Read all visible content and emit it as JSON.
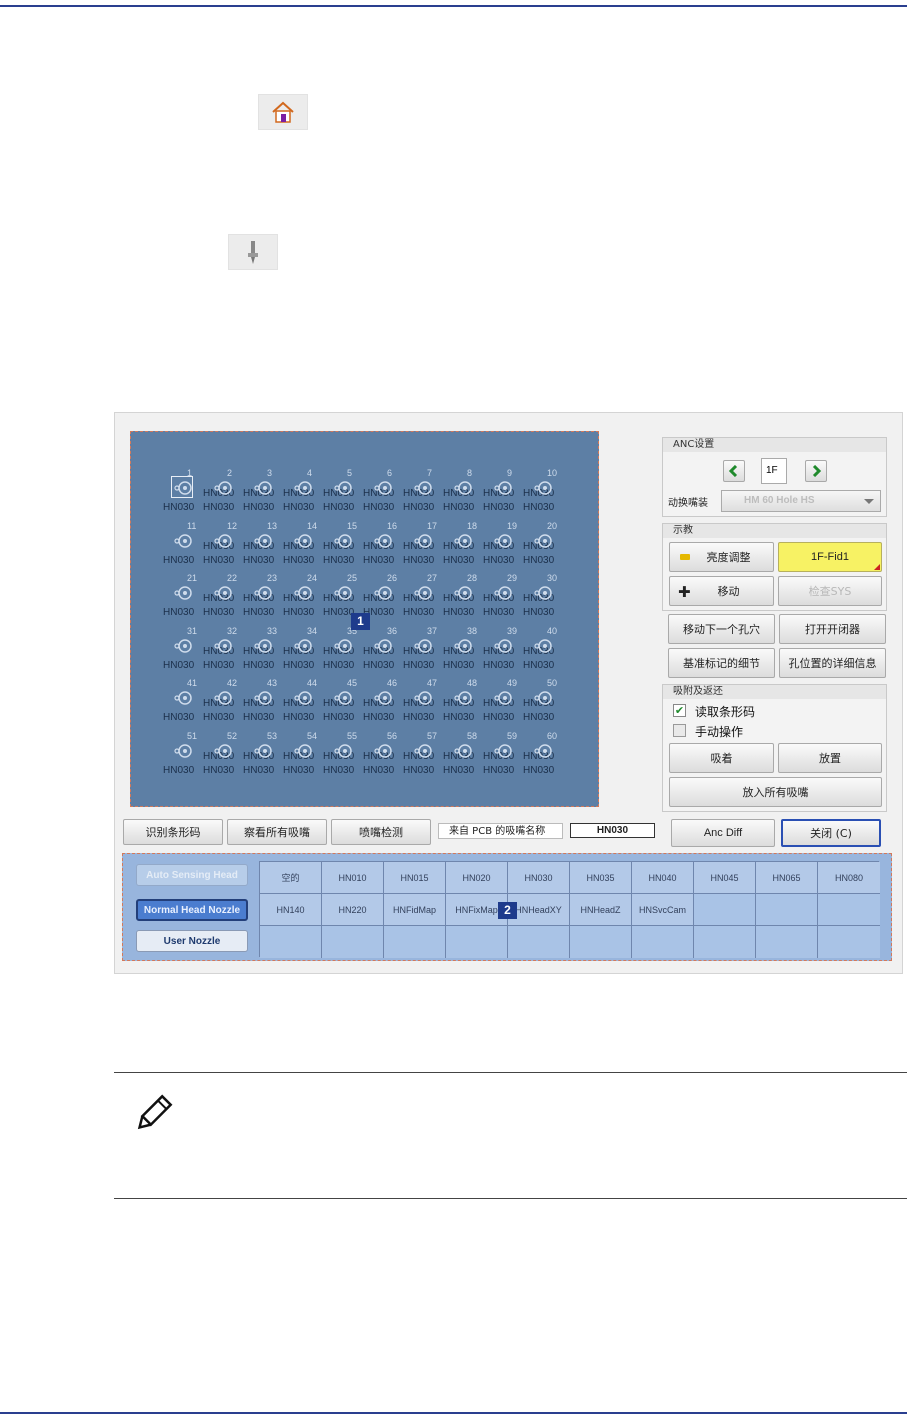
{
  "window": {
    "anc_group": {
      "title": "ANC设置",
      "station_value": "1F",
      "nozzle_change_label": "动换嘴装",
      "nozzle_change_value": "HM 60 Hole HS"
    },
    "teach_group": {
      "title": "示教",
      "brightness_button": "亮度调整",
      "fid_button": "1F-Fid1",
      "move_button": "移动",
      "check_sys_button": "检查SYS"
    },
    "hole_buttons": {
      "move_next": "移动下一个孔穴",
      "open_shutter": "打开开闭器",
      "fid_detail": "基准标记的细节",
      "hole_detail": "孔位置的详细信息"
    },
    "pickup_group": {
      "title": "吸附及返还",
      "read_barcode_label": "读取条形码",
      "read_barcode_checked": true,
      "manual_label": "手动操作",
      "manual_checked": false,
      "pick_button": "吸着",
      "place_button": "放置",
      "place_all_button": "放入所有吸嘴"
    },
    "bottom_bar": {
      "barcode_button": "识别条形码",
      "view_all_button": "察看所有吸嘴",
      "nozzle_check_button": "喷嘴检测",
      "pcb_nozzle_label": "来自 PCB 的吸嘴名称",
      "pcb_nozzle_value": "HN030",
      "anc_diff_button": "Anc Diff",
      "close_button": "关闭 (C)"
    },
    "nozzle_grid": {
      "label": "HN030",
      "callout": "1"
    },
    "nozzle_library": {
      "auto_sensing_button": "Auto Sensing Head",
      "normal_head_button": "Normal Head Nozzle",
      "user_nozzle_button": "User Nozzle",
      "callout": "2",
      "rows": [
        [
          "空的",
          "HN010",
          "HN015",
          "HN020",
          "HN030",
          "HN035",
          "HN040",
          "HN045",
          "HN065",
          "HN080"
        ],
        [
          "HN140",
          "HN220",
          "HNFidMap",
          "HNFixMap",
          "HNHeadXY",
          "HNHeadZ",
          "HNSvcCam",
          "",
          "",
          ""
        ],
        [
          "",
          "",
          "",
          "",
          "",
          "",
          "",
          "",
          "",
          ""
        ]
      ]
    }
  }
}
